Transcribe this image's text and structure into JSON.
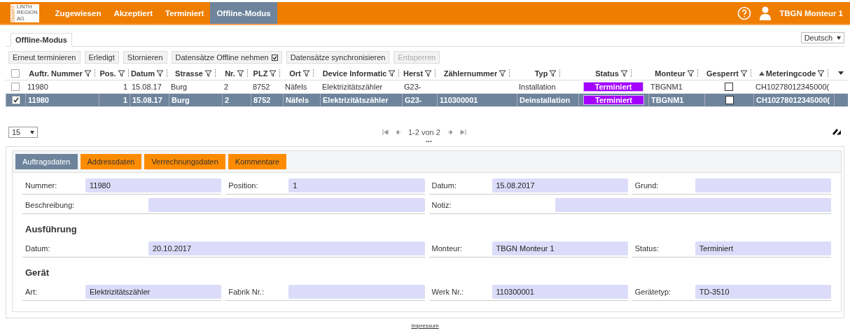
{
  "header": {
    "logo": [
      "LINTH",
      "REGION",
      "AG"
    ],
    "logo_side": "SMART",
    "nav": [
      {
        "label": "Zugewiesen",
        "selected": false
      },
      {
        "label": "Akzeptiert",
        "selected": false
      },
      {
        "label": "Terminiert",
        "selected": false
      },
      {
        "label": "Offline-Modus",
        "selected": true
      }
    ],
    "user": "TBGN Monteur 1"
  },
  "page_tab": "Offline-Modus",
  "language": "Deutsch",
  "toolbar": [
    {
      "label": "Erneut terminieren",
      "disabled": false,
      "checkbox": false
    },
    {
      "label": "Erledigt",
      "disabled": false,
      "checkbox": false
    },
    {
      "label": "Stornieren",
      "disabled": false,
      "checkbox": false
    },
    {
      "label": "Datensätze Offline nehmen",
      "disabled": false,
      "checkbox": true
    },
    {
      "label": "Datensätze synchronisieren",
      "disabled": false,
      "checkbox": false
    },
    {
      "label": "Entsperren",
      "disabled": true,
      "checkbox": false
    }
  ],
  "table": {
    "select_all_checked": false,
    "columns": [
      {
        "label": "Auftr. Nummer",
        "sorted": false
      },
      {
        "label": "Pos.",
        "sorted": false
      },
      {
        "label": "Datum",
        "sorted": false
      },
      {
        "label": "Strasse",
        "sorted": false
      },
      {
        "label": "Nr.",
        "sorted": false
      },
      {
        "label": "PLZ",
        "sorted": false
      },
      {
        "label": "Ort",
        "sorted": false
      },
      {
        "label": "Device Informatic",
        "sorted": false
      },
      {
        "label": "Herst",
        "sorted": false
      },
      {
        "label": "Zählernummer",
        "sorted": false
      },
      {
        "label": "Typ",
        "sorted": false
      },
      {
        "label": "Status",
        "sorted": false
      },
      {
        "label": "Monteur",
        "sorted": false
      },
      {
        "label": "Gesperrt",
        "sorted": false
      },
      {
        "label": "Meteringcode",
        "sorted": true
      }
    ],
    "rows": [
      {
        "selected": false,
        "cells": [
          "11980",
          "1",
          "15.08.17",
          "Burg",
          "2",
          "8752",
          "Näfels",
          "Elektrizitätszähler",
          "G23-",
          "",
          "Installation",
          "Terminiert",
          "TBGNM1",
          "",
          "CH10278012345000("
        ],
        "locked": false
      },
      {
        "selected": true,
        "cells": [
          "11980",
          "1",
          "15.08.17",
          "Burg",
          "2",
          "8752",
          "Näfels",
          "Elektrizitätszähler",
          "G23-",
          "110300001",
          "Deinstallation",
          "Terminiert",
          "TBGNM1",
          "",
          "CH10278012345000("
        ],
        "locked": false
      }
    ]
  },
  "pager": {
    "page_size": "15",
    "range": "1-2 von 2",
    "more": "..."
  },
  "detail_tabs": [
    {
      "label": "Auftragsdaten",
      "selected": true
    },
    {
      "label": "Addressdaten",
      "selected": false
    },
    {
      "label": "Verrechnungsdaten",
      "selected": false
    },
    {
      "label": "Kommentare",
      "selected": false
    }
  ],
  "sections": [
    {
      "lines": [
        {
          "fields": [
            {
              "label": "Nummer:",
              "value": "11980"
            },
            {
              "label": "Position:",
              "value": "1"
            },
            {
              "label": "Datum:",
              "value": "15.08.2017"
            },
            {
              "label": "Grund:"
            }
          ]
        },
        {
          "fields": [
            {
              "label": "Beschreibung:"
            },
            {
              "label": "Notiz:"
            }
          ]
        }
      ]
    },
    {
      "title": "Ausführung",
      "lines": [
        {
          "fields": [
            {
              "label": "Datum:",
              "value": "20.10.2017"
            },
            {
              "label": "Monteur:",
              "value": "TBGN Monteur 1"
            },
            {
              "label": "Status:",
              "value": "Terminiert"
            }
          ]
        }
      ]
    },
    {
      "title": "Gerät",
      "lines": [
        {
          "fields": [
            {
              "label": "Art:",
              "value": "Elektrizitätszähler"
            },
            {
              "label": "Fabrik Nr.:"
            },
            {
              "label": "Werk Nr.:",
              "value": "110300001"
            },
            {
              "label": "Gerätetyp:",
              "value": "TD-3510"
            }
          ]
        }
      ]
    }
  ],
  "footer_link": "Impressum"
}
